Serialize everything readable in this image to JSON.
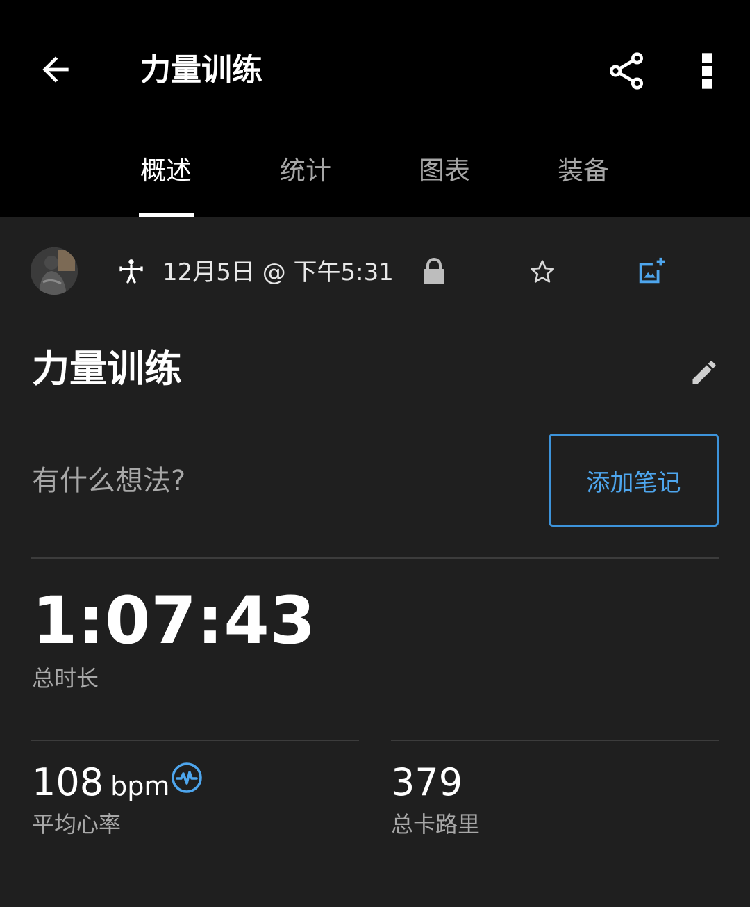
{
  "appbar": {
    "title": "力量训练",
    "back_icon": "arrow-left-icon",
    "share_icon": "share-icon",
    "more_icon": "more-vert-icon"
  },
  "tabs": [
    {
      "label": "概述",
      "active": true
    },
    {
      "label": "统计",
      "active": false
    },
    {
      "label": "图表",
      "active": false
    },
    {
      "label": "装备",
      "active": false
    }
  ],
  "meta": {
    "activity_icon": "strength-training-icon",
    "date": "12月5日 @ 下午5:31",
    "privacy_icon": "lock-icon",
    "favorite_icon": "star-outline-icon",
    "add_photo_icon": "add-photo-icon"
  },
  "activity": {
    "title": "力量训练",
    "edit_icon": "pencil-icon"
  },
  "notes": {
    "prompt": "有什么想法?",
    "add_button": "添加笔记"
  },
  "stats": {
    "duration_value": "1:07:43",
    "duration_label": "总时长",
    "heart_rate_value": "108",
    "heart_rate_unit": "bpm",
    "heart_rate_label": "平均心率",
    "heart_rate_icon": "heart-rate-pulse-icon",
    "calories_value": "379",
    "calories_label": "总卡路里"
  },
  "colors": {
    "background": "#1f1f1f",
    "appbar": "#000000",
    "accent": "#3d93da",
    "secondary_text": "#a8a8a8"
  }
}
